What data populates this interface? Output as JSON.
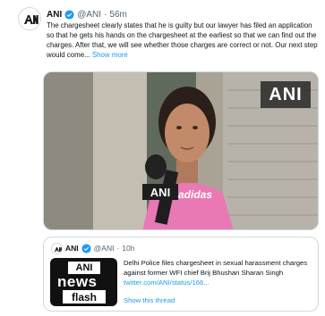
{
  "tweet": {
    "name": "ANI",
    "handle": "@ANI",
    "separator": "·",
    "time": "56m",
    "text": "The chargesheet clearly states that he is guilty but our lawyer has filed an application so that he gets his hands on the chargesheet at the earliest so that we can find out the charges. After that, we will see whether those charges are correct or not. Our next step would come...",
    "show_more": "Show more",
    "media_badge": "ANI",
    "mic_label": "ANI",
    "shirt_text": "adidas"
  },
  "quote": {
    "name": "ANI",
    "handle": "@ANI",
    "separator": "·",
    "time": "10h",
    "text": "Delhi Police files chargesheet in sexual harassment charges against former WFI chief Brij Bhushan Sharan Singh",
    "link": "twitter.com/ANI/status/166...",
    "show_thread": "Show this thread",
    "thumb_top": "ANI",
    "thumb_news": "news",
    "thumb_flash": "flash"
  },
  "colors": {
    "verified": "#1d9bf0",
    "link": "#1d9bf0",
    "shirt": "#e879b4"
  }
}
